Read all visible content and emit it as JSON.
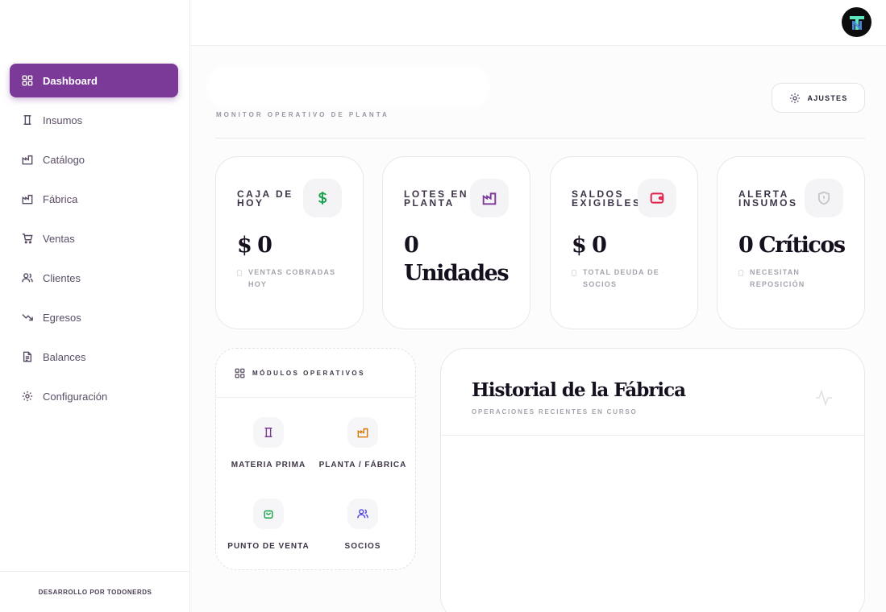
{
  "sidebar": {
    "items": [
      {
        "label": "Dashboard",
        "icon": "dashboard-grid-icon",
        "active": true
      },
      {
        "label": "Insumos",
        "icon": "spool-icon"
      },
      {
        "label": "Catálogo",
        "icon": "factory-icon"
      },
      {
        "label": "Fábrica",
        "icon": "factory-icon"
      },
      {
        "label": "Ventas",
        "icon": "cart-icon"
      },
      {
        "label": "Clientes",
        "icon": "users-icon"
      },
      {
        "label": "Egresos",
        "icon": "trending-down-icon"
      },
      {
        "label": "Balances",
        "icon": "document-icon"
      },
      {
        "label": "Configuración",
        "icon": "gear-icon"
      }
    ],
    "footer": "DESARROLLO POR TODONERDS"
  },
  "header": {
    "subtitle": "MONITOR OPERATIVO DE PLANTA",
    "settings_label": "AJUSTES"
  },
  "stats": [
    {
      "title": "CAJA DE HOY",
      "value": "$ 0",
      "note": "VENTAS COBRADAS HOY",
      "icon": "dollar-icon",
      "color": "#16a34a"
    },
    {
      "title": "LOTES EN PLANTA",
      "value": "0 Unidades",
      "note": "",
      "icon": "factory-icon",
      "color": "#7b3a97"
    },
    {
      "title": "SALDOS EXIGIBLES",
      "value": "$ 0",
      "note": "TOTAL DEUDA DE SOCIOS",
      "icon": "wallet-icon",
      "color": "#e11d48"
    },
    {
      "title": "ALERTA INSUMOS",
      "value": "0 Críticos",
      "note": "NECESITAN REPOSICIÓN",
      "icon": "shield-alert-icon",
      "color": "#c9c6ce"
    }
  ],
  "modules": {
    "title": "MÓDULOS OPERATIVOS",
    "items": [
      {
        "label": "MATERIA PRIMA",
        "icon": "spool-icon",
        "color": "#7b3a97"
      },
      {
        "label": "PLANTA / FÁBRICA",
        "icon": "factory-icon",
        "color": "#d97706"
      },
      {
        "label": "PUNTO DE VENTA",
        "icon": "shopping-bag-icon",
        "color": "#16a34a"
      },
      {
        "label": "SOCIOS",
        "icon": "users-icon",
        "color": "#4f46e5"
      }
    ]
  },
  "history": {
    "title": "Historial de la Fábrica",
    "subtitle": "OPERACIONES RECIENTES EN CURSO",
    "icon": "activity-icon"
  },
  "user": {
    "avatar": "TN"
  }
}
